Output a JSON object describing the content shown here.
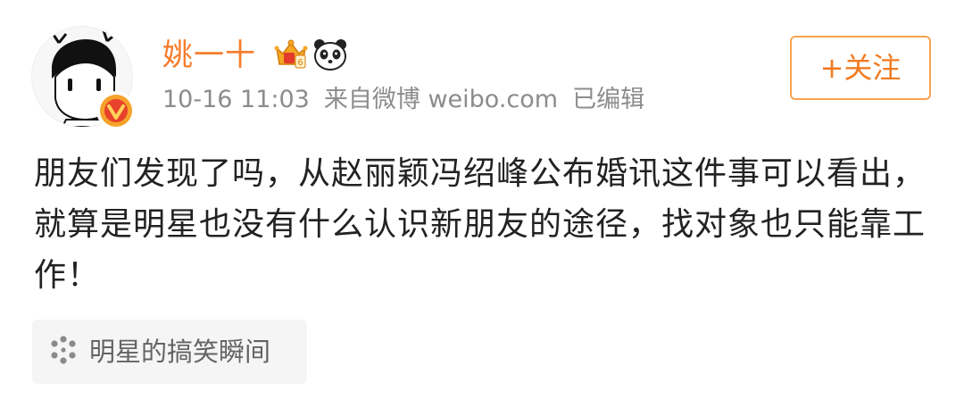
{
  "post": {
    "author": {
      "name": "姚一十",
      "badges": [
        "crown-member-icon",
        "panda-icon"
      ],
      "verified": true
    },
    "meta": {
      "time": "10-16 11:03",
      "source": "来自微博 weibo.com",
      "edited": "已编辑"
    },
    "follow_label": "+关注",
    "content": "朋友们发现了吗，从赵丽颖冯绍峰公布婚讯这件事可以看出，就算是明星也没有什么认识新朋友的途径，找对象也只能靠工作！",
    "topic": {
      "icon": "topic-dots-icon",
      "label": "明星的搞笑瞬间"
    }
  },
  "colors": {
    "username": "#f77c2c",
    "meta": "#8c8c8c",
    "follow_border": "#f7a34f",
    "follow_text": "#f07b22",
    "content_text": "#222222",
    "topic_bg": "#f5f5f5",
    "verified_badge": "#f6a22b"
  }
}
